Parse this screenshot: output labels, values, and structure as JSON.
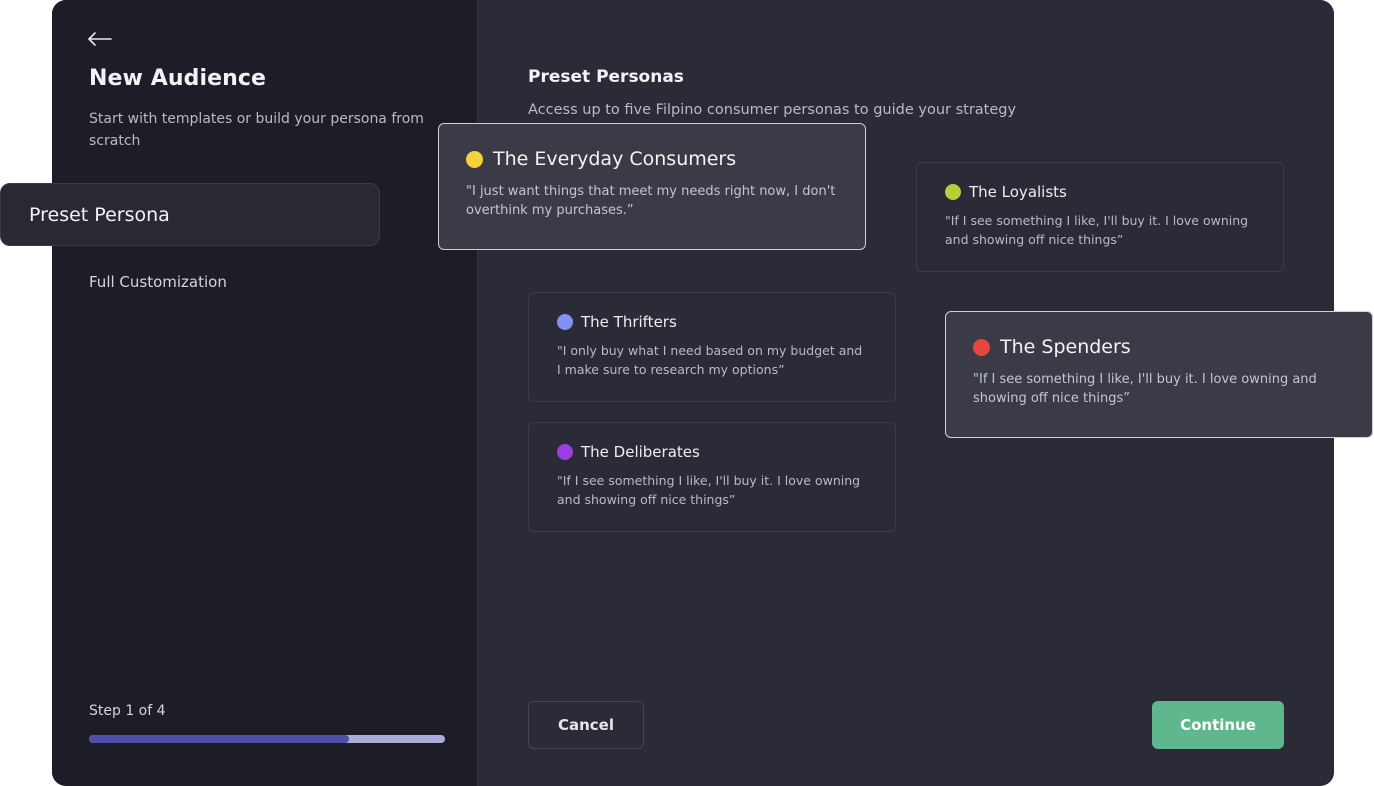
{
  "sidebar": {
    "back_icon": "arrow-left-icon",
    "title": "New Audience",
    "subtitle": "Start with templates or build your persona from scratch",
    "items": [
      {
        "label": "Preset Persona",
        "selected": true
      },
      {
        "label": "Full Customization",
        "selected": false
      }
    ],
    "step_label": "Step 1 of 4",
    "progress_fraction": 0.73,
    "progress_fill_color": "#4d4fa8",
    "progress_track_color": "#a9abd8"
  },
  "main": {
    "title": "Preset Personas",
    "subtitle": "Access up to five Filpino consumer personas to guide your strategy",
    "personas": [
      {
        "name": "The Everyday Consumers",
        "quote": "\"I just want things that meet my needs right now, I don't overthink my purchases.”",
        "color": "#f3d23c",
        "highlighted": true
      },
      {
        "name": "The Loyalists",
        "quote": "\"If I see something I like, I'll buy it. I love owning and showing off nice things”",
        "color": "#b5cf3a",
        "highlighted": false
      },
      {
        "name": "The Thrifters",
        "quote": "\"I only buy what I need based on my budget and I make sure to research my options”",
        "color": "#8391f0",
        "highlighted": false
      },
      {
        "name": "The Spenders",
        "quote": "\"If I see something I like, I'll buy it. I love owning and showing off nice things”",
        "color": "#e8453c",
        "highlighted": true
      },
      {
        "name": "The Deliberates",
        "quote": "\"If I see something I like, I'll buy it. I love owning and showing off nice things”",
        "color": "#9a3fe0",
        "highlighted": false
      }
    ],
    "cancel_label": "Cancel",
    "continue_label": "Continue",
    "continue_color": "#5fb78e"
  }
}
